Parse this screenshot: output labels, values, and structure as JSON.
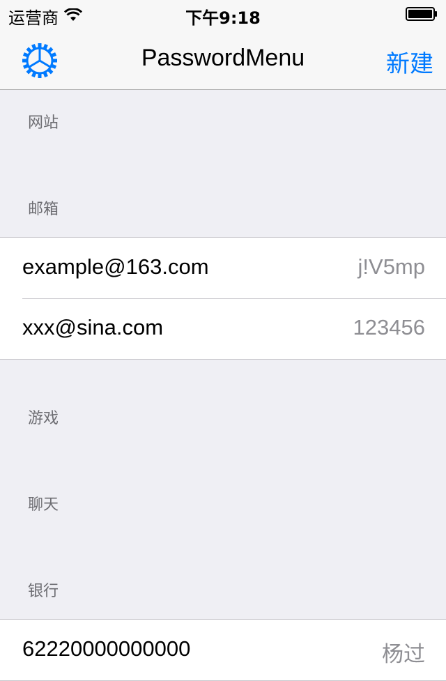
{
  "status_bar": {
    "carrier": "运营商",
    "time": "下午9:18"
  },
  "nav": {
    "title": "PasswordMenu",
    "settings_icon": "gear-icon",
    "new_label": "新建",
    "accent_color": "#007aff"
  },
  "sections": [
    {
      "header": "网站",
      "rows": []
    },
    {
      "header": "邮箱",
      "rows": [
        {
          "title": "example@163.com",
          "detail": "j!V5mp"
        },
        {
          "title": "xxx@sina.com",
          "detail": "123456"
        }
      ]
    },
    {
      "header": "游戏",
      "rows": []
    },
    {
      "header": "聊天",
      "rows": []
    },
    {
      "header": "银行",
      "rows": [
        {
          "title": "62220000000000",
          "detail": "杨过"
        }
      ]
    }
  ]
}
